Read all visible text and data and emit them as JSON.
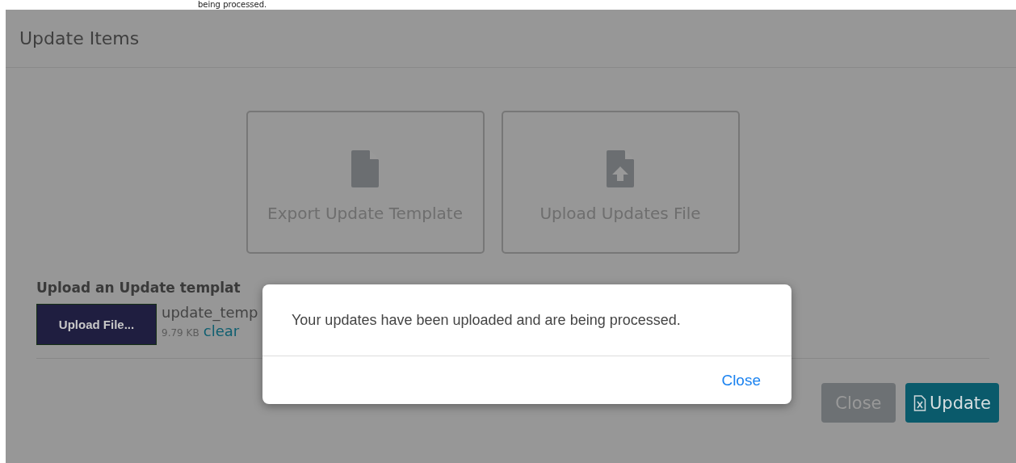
{
  "background_text": "being processed.",
  "dialog": {
    "title": "Update Items",
    "cards": [
      {
        "kind": "csv",
        "label": "Export Update Template"
      },
      {
        "kind": "upload",
        "label": "Upload Updates File"
      }
    ],
    "upload_section": {
      "label": "Upload an Update templat",
      "button": "Upload File...",
      "file_name": "update_temp",
      "file_size": "9.79 KB",
      "clear_link": "clear"
    },
    "footer_buttons": [
      {
        "kind": "secondary",
        "label": "Close",
        "disabled": true
      },
      {
        "kind": "primary",
        "label": "Update"
      }
    ]
  },
  "alert": {
    "message": "Your updates have been uploaded and are being processed.",
    "button": "Close"
  }
}
